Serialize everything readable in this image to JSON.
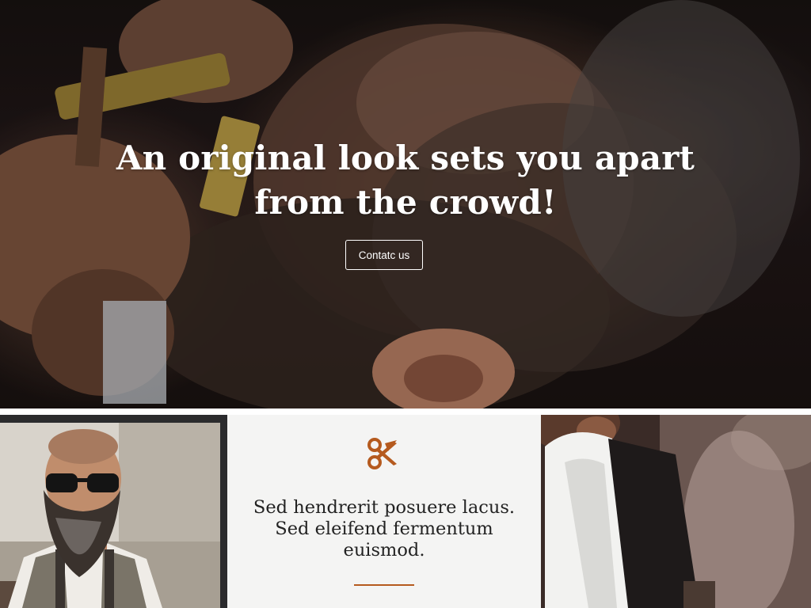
{
  "hero": {
    "title_line1": "An original look sets you apart",
    "title_line2": "from the crowd!",
    "contact_button_label": "Contatc us"
  },
  "feature": {
    "icon": "scissors-icon",
    "text": "Sed hendrerit posuere lacus. Sed eleifend fermentum euismod."
  },
  "colors": {
    "accent": "#b55a1e",
    "panel_bg": "#f4f4f3",
    "dark_panel": "#2b2b2d"
  }
}
